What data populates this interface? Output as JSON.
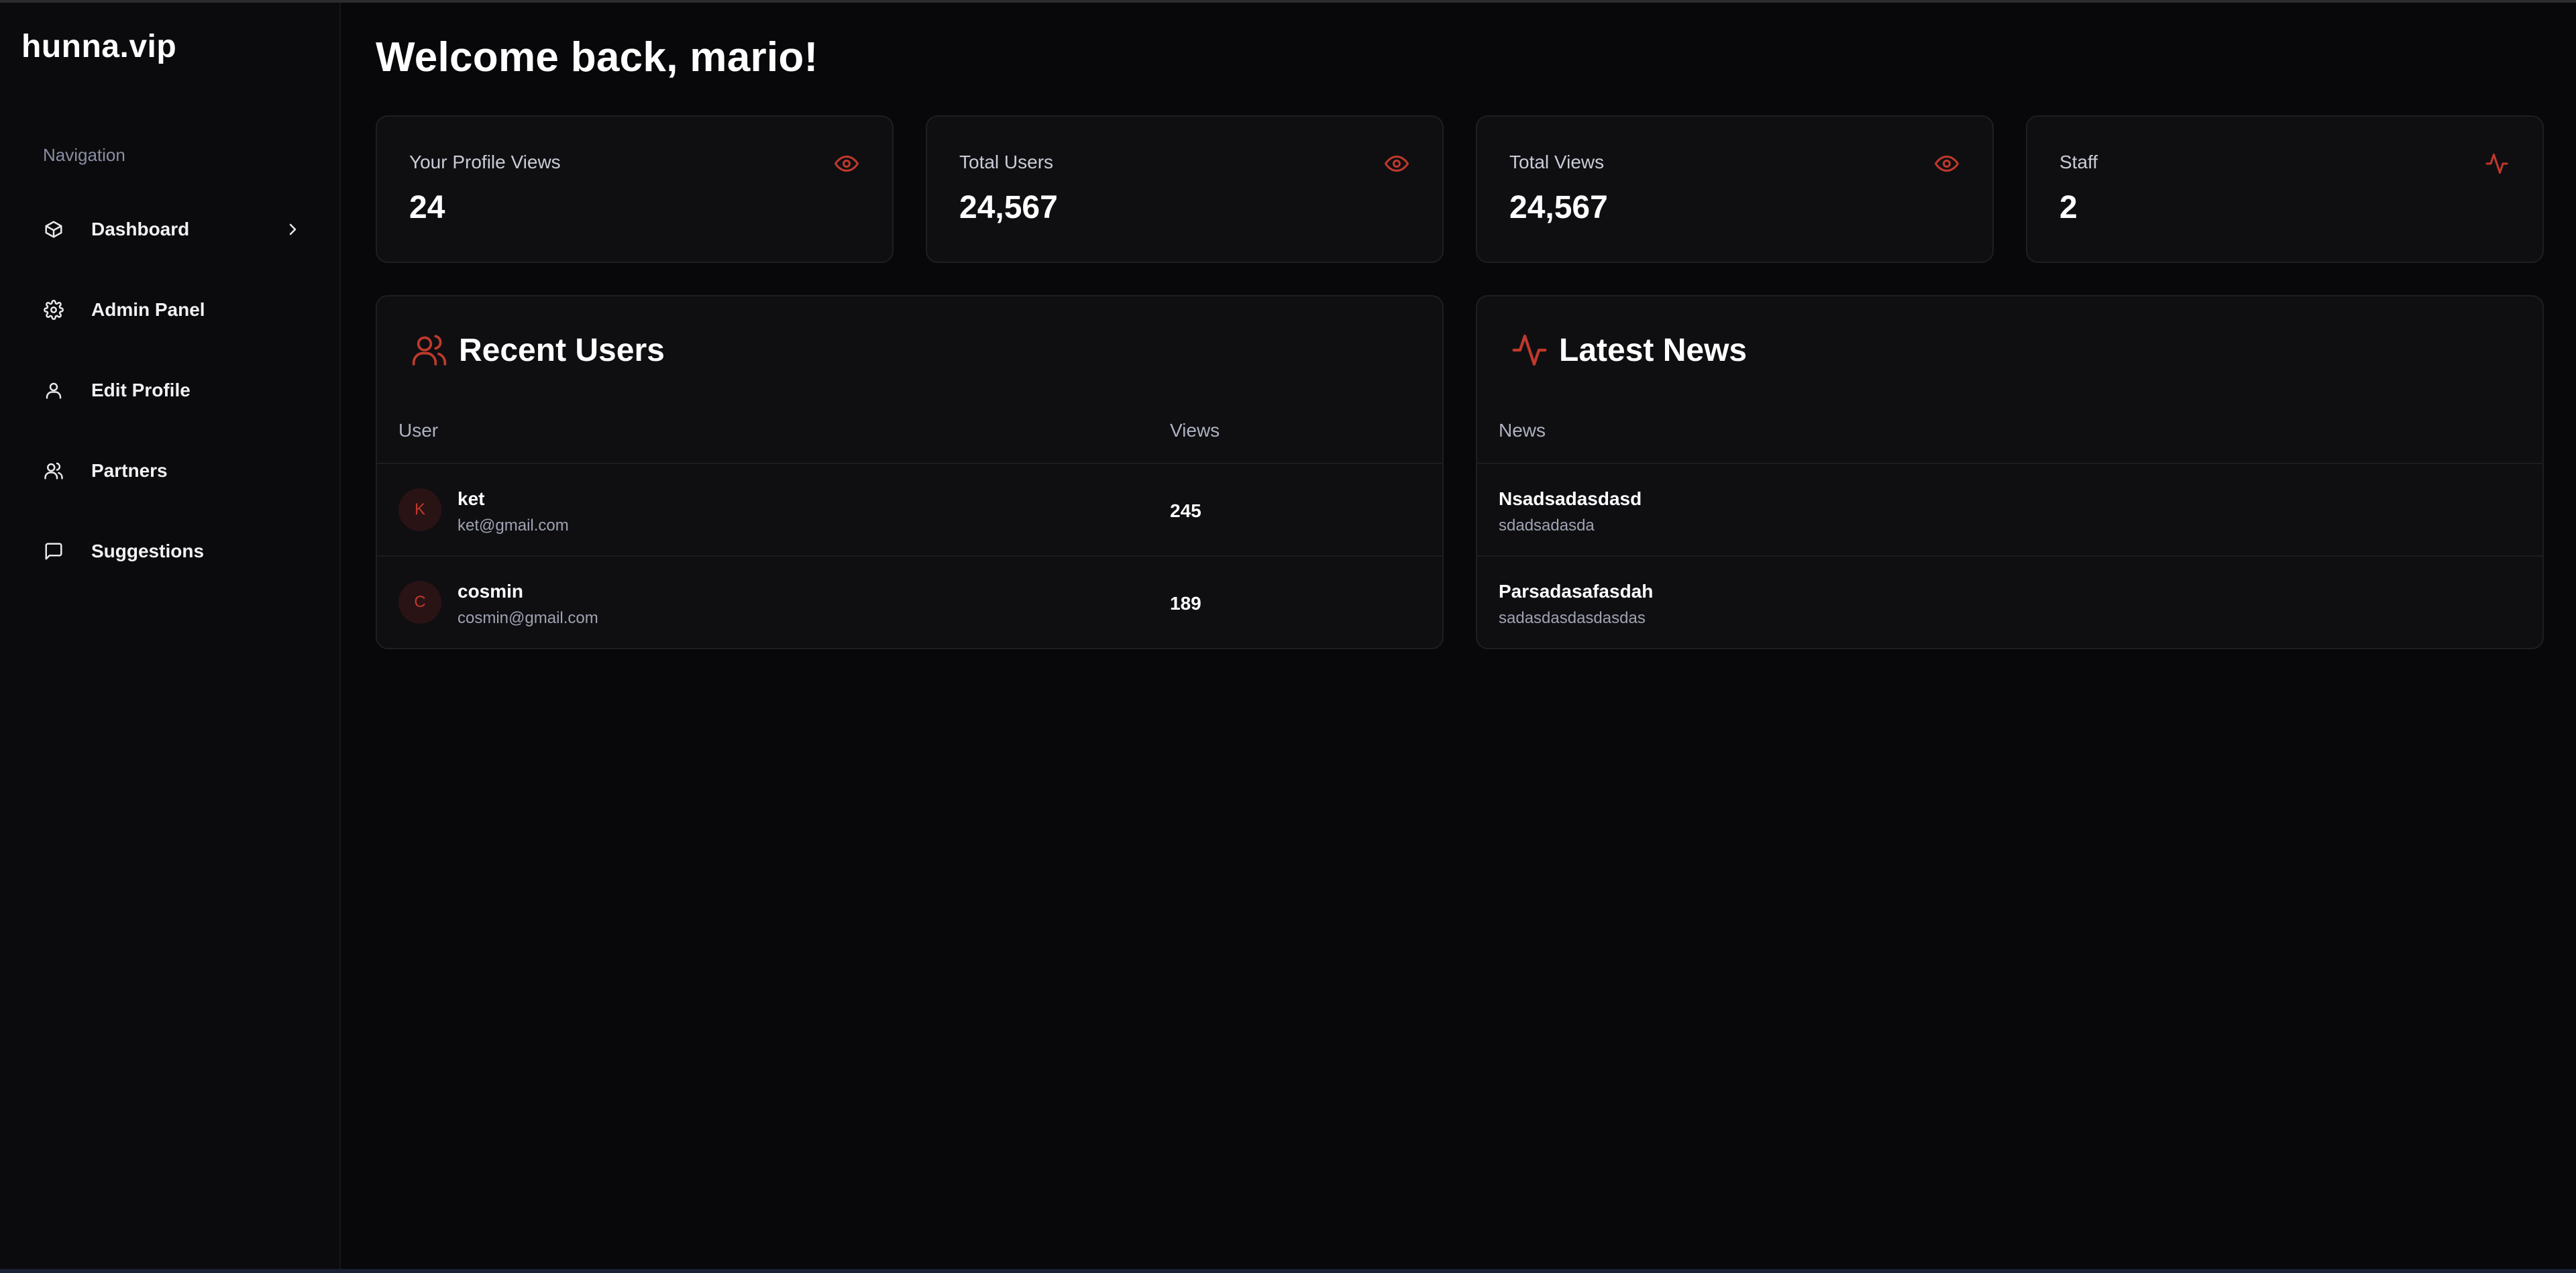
{
  "brand": {
    "name": "hunna.vip"
  },
  "sidebar": {
    "heading": "Navigation",
    "items": [
      {
        "label": "Dashboard",
        "icon": "box-icon",
        "active": true
      },
      {
        "label": "Admin Panel",
        "icon": "gear-icon"
      },
      {
        "label": "Edit Profile",
        "icon": "user-icon"
      },
      {
        "label": "Partners",
        "icon": "users-icon"
      },
      {
        "label": "Suggestions",
        "icon": "message-square-icon"
      }
    ]
  },
  "header": {
    "title": "Welcome back, mario!"
  },
  "stats": [
    {
      "label": "Your Profile Views",
      "value": "24",
      "icon": "eye-icon"
    },
    {
      "label": "Total Users",
      "value": "24,567",
      "icon": "eye-icon"
    },
    {
      "label": "Total Views",
      "value": "24,567",
      "icon": "eye-icon"
    },
    {
      "label": "Staff",
      "value": "2",
      "icon": "activity-icon"
    }
  ],
  "recent_users": {
    "title": "Recent Users",
    "columns": {
      "user": "User",
      "views": "Views"
    },
    "rows": [
      {
        "initial": "K",
        "name": "ket",
        "email": "ket@gmail.com",
        "views": "245"
      },
      {
        "initial": "C",
        "name": "cosmin",
        "email": "cosmin@gmail.com",
        "views": "189"
      }
    ]
  },
  "latest_news": {
    "title": "Latest News",
    "columns": {
      "news": "News"
    },
    "rows": [
      {
        "title": "Nsadsadasdasd",
        "subtitle": "sdadsadasda"
      },
      {
        "title": "Parsadasafasdah",
        "subtitle": "sadasdasdasdasdas"
      }
    ]
  },
  "colors": {
    "accent": "#c0392b",
    "background": "#08080b",
    "card": "#0f0f12",
    "border": "#1e1e23",
    "muted_text": "#9fa3b2"
  }
}
